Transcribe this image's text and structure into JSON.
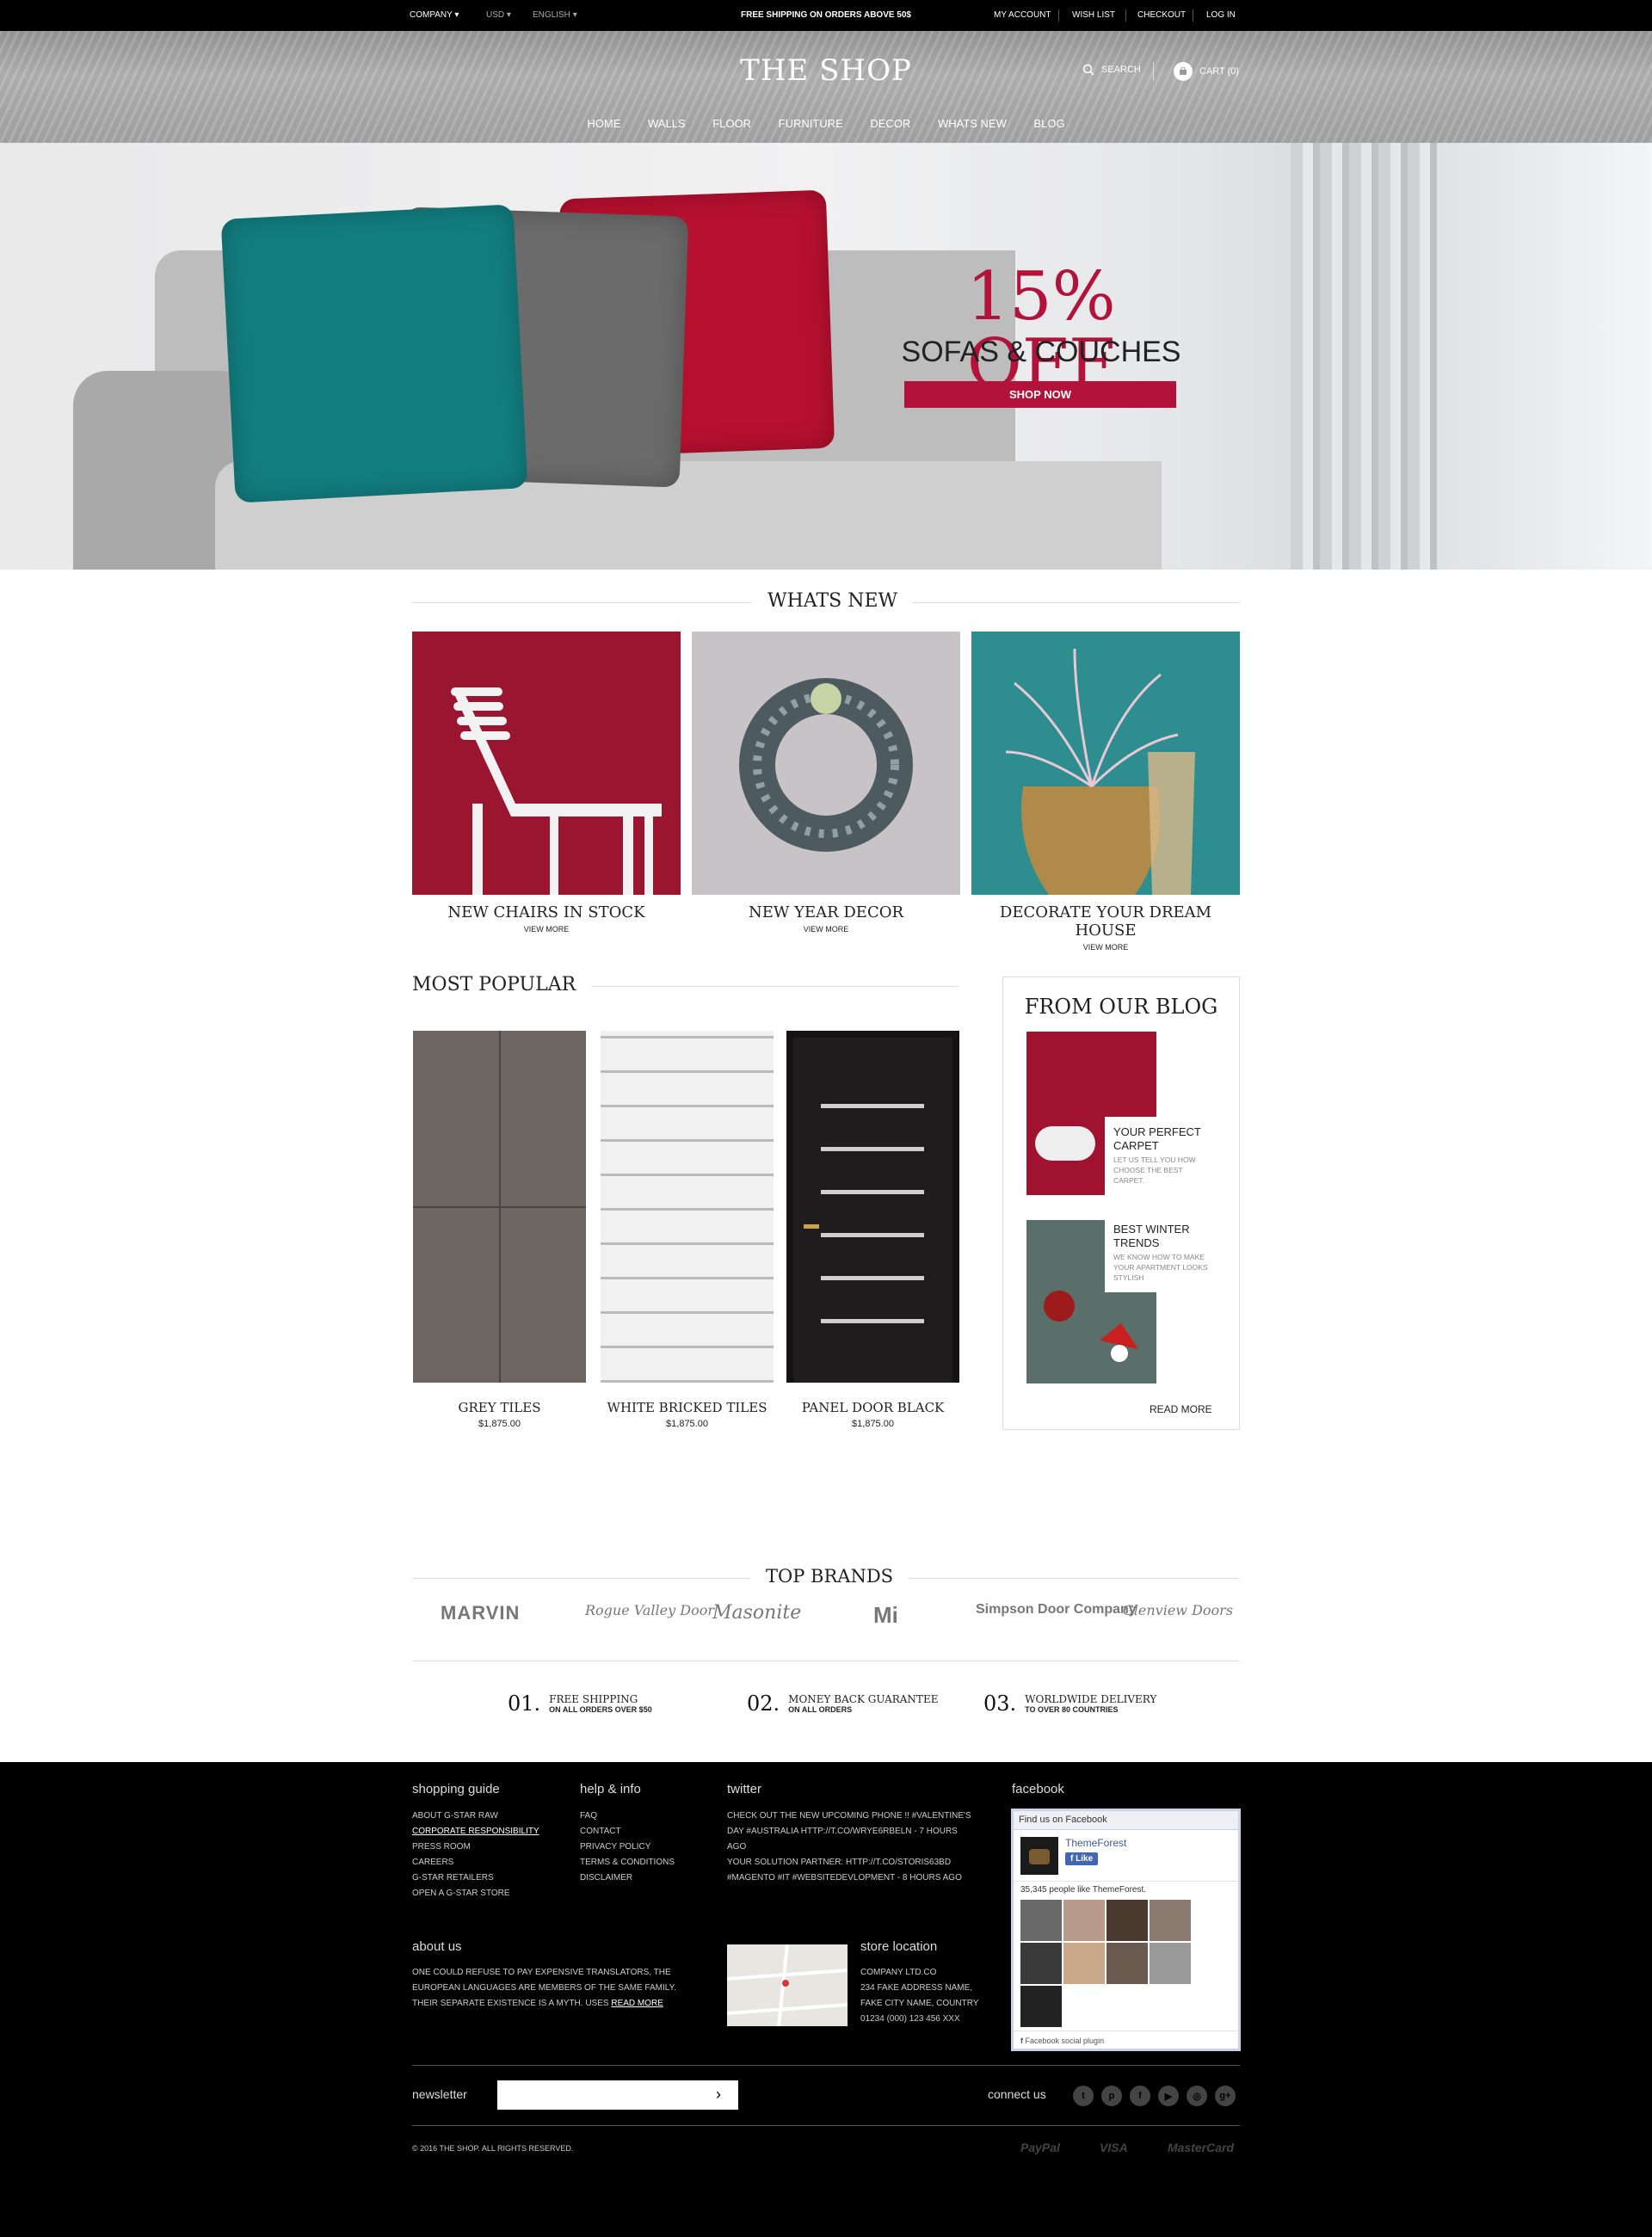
{
  "topbar": {
    "company": "COMPANY",
    "currency": "USD",
    "language": "ENGLISH",
    "promo": "FREE SHIPPING ON ORDERS ABOVE 50$",
    "my_account": "MY ACCOUNT",
    "wish_list": "WISH LIST",
    "checkout": "CHECKOUT",
    "login": "LOG IN"
  },
  "header": {
    "logo": "THE SHOP",
    "search": "SEARCH",
    "cart": "CART (0)",
    "nav": [
      "HOME",
      "WALLS",
      "FLOOR",
      "FURNITURE",
      "DECOR",
      "WHATS NEW",
      "BLOG"
    ]
  },
  "hero": {
    "headline": "15% OFF",
    "subheadline": "SOFAS & COUCHES",
    "button": "SHOP NOW",
    "accent": "#b3123a"
  },
  "whats_new": {
    "title": "WHATS NEW",
    "items": [
      {
        "name": "NEW CHAIRS IN STOCK",
        "link": "VIEW MORE"
      },
      {
        "name": "NEW YEAR DECOR",
        "link": "VIEW MORE"
      },
      {
        "name": "DECORATE YOUR DREAM HOUSE",
        "link": "VIEW MORE"
      }
    ]
  },
  "most_popular": {
    "title": "MOST POPULAR",
    "items": [
      {
        "name": "GREY TILES",
        "price": "$1,875.00"
      },
      {
        "name": "WHITE BRICKED TILES",
        "price": "$1,875.00"
      },
      {
        "name": "PANEL DOOR BLACK",
        "price": "$1,875.00"
      }
    ]
  },
  "blog": {
    "title": "FROM OUR BLOG",
    "posts": [
      {
        "title": "YOUR PERFECT CARPET",
        "desc": "LET US TELL YOU HOW CHOOSE THE BEST CARPET."
      },
      {
        "title": "BEST WINTER TRENDS",
        "desc": "WE KNOW HOW TO MAKE YOUR APARTMENT LOOKS STYLISH"
      }
    ],
    "read_more": "READ MORE"
  },
  "brands": {
    "title": "TOP BRANDS",
    "items": [
      "MARVIN",
      "Rogue Valley Door",
      "Masonite",
      "Mi",
      "Simpson Door Company",
      "Glenview Doors"
    ]
  },
  "features": [
    {
      "num": "01.",
      "title": "FREE SHIPPING",
      "sub": "ON ALL ORDERS OVER $50"
    },
    {
      "num": "02.",
      "title": "MONEY BACK GUARANTEE",
      "sub": "ON ALL ORDERS"
    },
    {
      "num": "03.",
      "title": "WORLDWIDE DELIVERY",
      "sub": "TO OVER 80 COUNTRIES"
    }
  ],
  "footer": {
    "shopping_guide": {
      "title": "shopping guide",
      "links": [
        "ABOUT G-STAR RAW",
        "CORPORATE RESPONSIBILITY",
        "PRESS ROOM",
        "CAREERS",
        "G-STAR RETAILERS",
        "OPEN A G-STAR STORE"
      ]
    },
    "help_info": {
      "title": "help & info",
      "links": [
        "FAQ",
        "CONTACT",
        "PRIVACY POLICY",
        "TERMS & CONDITIONS",
        "DISCLAIMER"
      ]
    },
    "twitter": {
      "title": "twitter",
      "tweet1": "CHECK OUT THE NEW UPCOMING PHONE !! #VALENTINE'S DAY #AUSTRALIA HTTP://T.CO/WRYE6RBELN - 7 HOURS AGO",
      "tweet2": "YOUR SOLUTION PARTNER: HTTP://T.CO/STORIS63BD #MAGENTO #IT #WEBSITEDEVLOPMENT - 8 HOURS AGO"
    },
    "facebook": {
      "title": "facebook",
      "box_title": "Find us on Facebook",
      "page_name": "ThemeForest",
      "like": "Like",
      "likes_text": "35,345 people like ThemeForest.",
      "plugin": "Facebook social plugin"
    },
    "about": {
      "title": "about us",
      "text": "ONE COULD REFUSE TO PAY EXPENSIVE TRANSLATORS, THE EUROPEAN LANGUAGES ARE MEMBERS OF THE SAME FAMILY. THEIR SEPARATE EXISTENCE IS A MYTH. USES",
      "read_more": "READ MORE"
    },
    "store": {
      "title": "store location",
      "lines": [
        "COMPANY LTD.CO",
        "234 FAKE ADDRESS NAME,",
        "FAKE CITY NAME, COUNTRY",
        "01234 (000) 123 456 XXX"
      ]
    },
    "newsletter": {
      "label": "newsletter",
      "placeholder": ""
    },
    "connect": "connect us",
    "social": [
      "twitter-icon",
      "pinterest-icon",
      "facebook-icon",
      "youtube-icon",
      "instagram-icon",
      "google-plus-icon"
    ],
    "copyright": "© 2016 THE SHOP. ALL RIGHTS RESERVED.",
    "payments": [
      "PayPal",
      "VISA",
      "MasterCard"
    ]
  }
}
